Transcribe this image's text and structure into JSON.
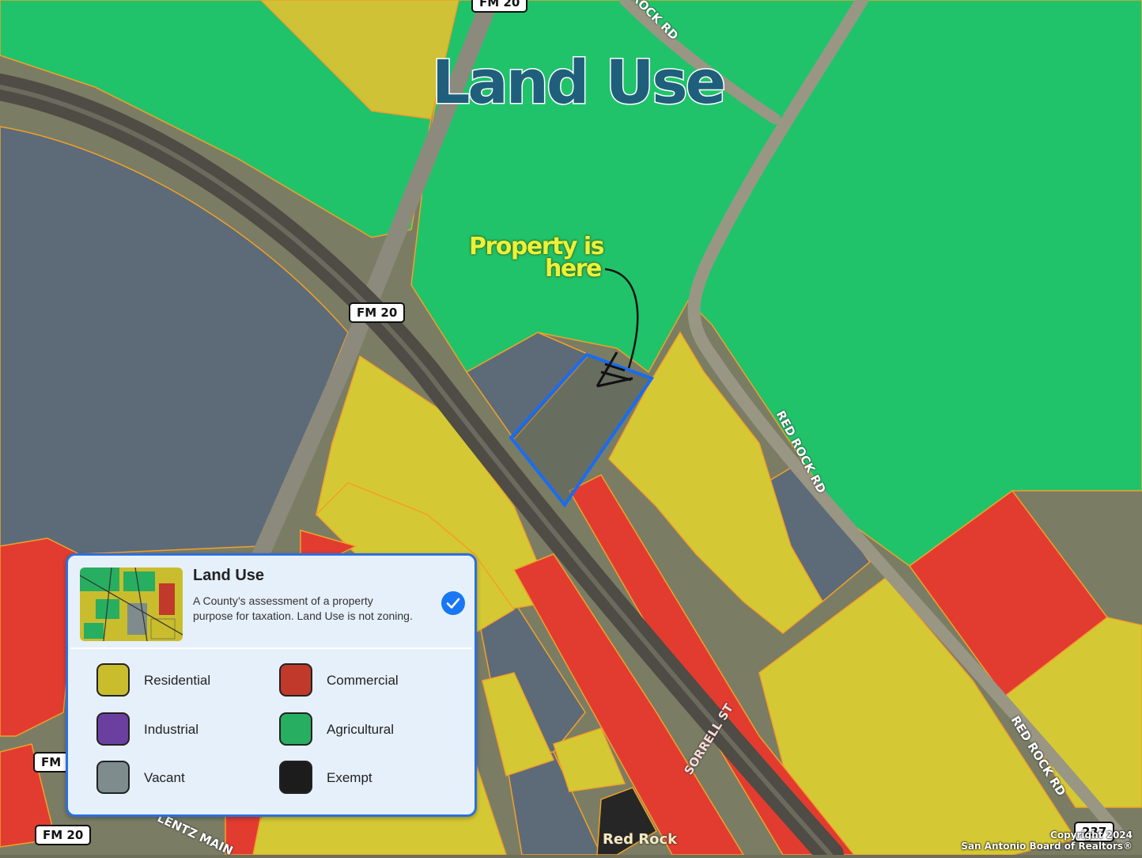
{
  "title": "Land Use",
  "annotation": {
    "line1": "Property is",
    "line2": "here"
  },
  "roads": {
    "fm20_top": "FM 20",
    "fm20_mid": "FM 20",
    "fm20_left": "FM",
    "fm20_bottom": "FM 20",
    "red_rock_top": "ROCK RD",
    "red_rock_mid": "RED ROCK RD",
    "red_rock_bottom": "RED ROCK RD",
    "sorrell": "SORRELL ST",
    "route_237": "237",
    "lentz": "LENTZ MAIN",
    "poi_red_rock": "Red Rock"
  },
  "legend": {
    "title": "Land Use",
    "description": "A County’s assessment of a property purpose for taxation. Land Use is not zoning.",
    "checked": true,
    "items": [
      {
        "label": "Residential",
        "color": "#c9bd2e"
      },
      {
        "label": "Commercial",
        "color": "#c0392b"
      },
      {
        "label": "Industrial",
        "color": "#6b3fa0"
      },
      {
        "label": "Agricultural",
        "color": "#27ae60"
      },
      {
        "label": "Vacant",
        "color": "#7f8c8d"
      },
      {
        "label": "Exempt",
        "color": "#1c1c1c"
      }
    ]
  },
  "colors": {
    "agricultural_overlay": "#1fc46a",
    "residential_overlay": "#d4c934",
    "commercial_overlay": "#e0392e",
    "vacant_overlay": "#5f6f80",
    "parcel_outline": "#f2a02a",
    "property_outline": "#1a6cf0",
    "title": "#1f5f7c",
    "annotation": "#e9f23a",
    "checkmark": "#1877f2"
  },
  "copyright": {
    "line1": "Copyright 2024",
    "line2": "San Antonio Board of Realtors®"
  }
}
